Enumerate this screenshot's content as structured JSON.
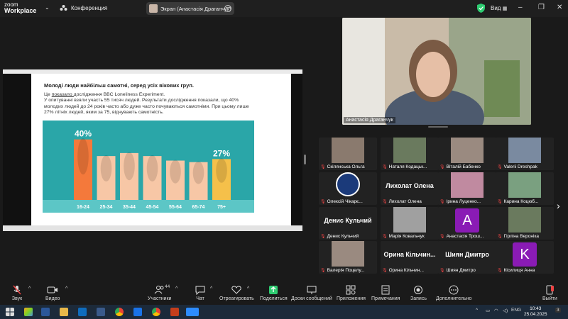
{
  "app": {
    "logo_line1": "zoom",
    "logo_line2": "Workplace",
    "meeting_title": "Конференция",
    "share_label": "Экран (Анастасія Драганчук)",
    "view_label": "Вид"
  },
  "colors": {
    "accent_green": "#2ecc71",
    "mic_muted": "#e44444",
    "slide_teal": "#2aa6a8",
    "bar_orange": "#f4793b",
    "bar_peach": "#f7c7a6",
    "bar_yellow": "#f5c04a",
    "avatar_purple": "#8a1bb5"
  },
  "slide": {
    "title": "Молоді люди найбільш самотні, серед усіх вікових груп.",
    "line1_pre": "Це ",
    "line1_link": "показало ",
    "line1_post": "дослідження BBC Loneliness Experiment.",
    "line2": "У опитуванні взяли участь 55 тисяч людей. Результати дослідження показали, що 40% молодих людей до 24 років часто або дуже часто почуваються самотніми. При цьому лише 27% літніх людей, яким за 75, відчувають самотність."
  },
  "chart_data": {
    "type": "bar",
    "categories": [
      "16-24",
      "25-34",
      "35-44",
      "45-54",
      "55-64",
      "65-74",
      "75+"
    ],
    "values": [
      40,
      29,
      31,
      29,
      26,
      25,
      27
    ],
    "data_labels": [
      "40%",
      "",
      "",
      "",
      "",
      "",
      "27%"
    ],
    "highlight": {
      "first": "orange",
      "last": "yellow"
    },
    "ylim": [
      0,
      45
    ],
    "grid": false
  },
  "speaker": {
    "name": "Анастасія Драганчук"
  },
  "gallery": {
    "tiles": [
      {
        "name": "Скілянська Ольга",
        "kind": "photo"
      },
      {
        "name": "Наталя Кодацьк...",
        "kind": "photo"
      },
      {
        "name": "Віталій Бабенко",
        "kind": "photo"
      },
      {
        "name": "Valerii Dreshpak",
        "kind": "photo"
      },
      {
        "name": "Олексій Чікарє...",
        "kind": "logo"
      },
      {
        "name": "Лихолат Олена",
        "big": "Лихолат Олена",
        "kind": "text"
      },
      {
        "name": "Ірина Луценко...",
        "kind": "photo"
      },
      {
        "name": "Карина Коцюб...",
        "kind": "photo"
      },
      {
        "name": "Денис Кульчий",
        "big": "Денис Кульчий",
        "kind": "text"
      },
      {
        "name": "Марія Ковальчук",
        "kind": "photo"
      },
      {
        "name": "Анастасія Трош...",
        "letter": "A",
        "kind": "letter"
      },
      {
        "name": "Гірліна Вероніка",
        "kind": "photo"
      },
      {
        "name": "Валерія Поцелу...",
        "kind": "photo"
      },
      {
        "name": "Орина Кільчин...",
        "big": "Орина Кільчин...",
        "kind": "text"
      },
      {
        "name": "Шиян Дмитро",
        "big": "Шиян Дмитро",
        "kind": "text"
      },
      {
        "name": "Кісилиця Анна",
        "letter": "K",
        "kind": "letter"
      }
    ]
  },
  "toolbar": {
    "audio": "Звук",
    "video": "Видео",
    "participants": "Участники",
    "participants_count": "44",
    "chat": "Чат",
    "react": "Отреагировать",
    "share": "Поделиться",
    "whiteboards": "Доски сообщений",
    "apps": "Приложения",
    "notes": "Примечания",
    "record": "Запись",
    "more": "Дополнительно",
    "leave": "Выйти"
  },
  "taskbar": {
    "lang": "ENG",
    "time": "10:43",
    "date": "25.04.2025",
    "notif": "3"
  }
}
